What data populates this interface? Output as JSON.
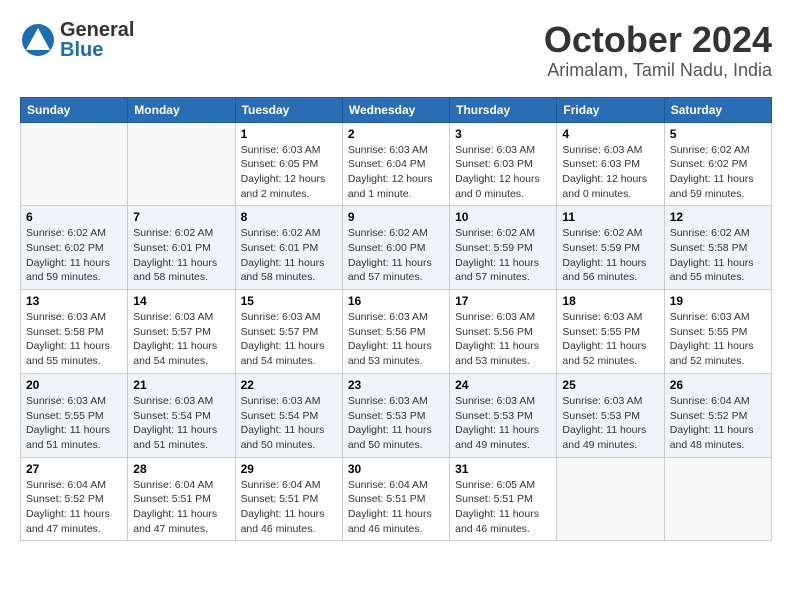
{
  "header": {
    "logo_general": "General",
    "logo_blue": "Blue",
    "title": "October 2024",
    "subtitle": "Arimalam, Tamil Nadu, India"
  },
  "days_of_week": [
    "Sunday",
    "Monday",
    "Tuesday",
    "Wednesday",
    "Thursday",
    "Friday",
    "Saturday"
  ],
  "weeks": [
    [
      {
        "day": "",
        "info": ""
      },
      {
        "day": "",
        "info": ""
      },
      {
        "day": "1",
        "info": "Sunrise: 6:03 AM\nSunset: 6:05 PM\nDaylight: 12 hours\nand 2 minutes."
      },
      {
        "day": "2",
        "info": "Sunrise: 6:03 AM\nSunset: 6:04 PM\nDaylight: 12 hours\nand 1 minute."
      },
      {
        "day": "3",
        "info": "Sunrise: 6:03 AM\nSunset: 6:03 PM\nDaylight: 12 hours\nand 0 minutes."
      },
      {
        "day": "4",
        "info": "Sunrise: 6:03 AM\nSunset: 6:03 PM\nDaylight: 12 hours\nand 0 minutes."
      },
      {
        "day": "5",
        "info": "Sunrise: 6:02 AM\nSunset: 6:02 PM\nDaylight: 11 hours\nand 59 minutes."
      }
    ],
    [
      {
        "day": "6",
        "info": "Sunrise: 6:02 AM\nSunset: 6:02 PM\nDaylight: 11 hours\nand 59 minutes."
      },
      {
        "day": "7",
        "info": "Sunrise: 6:02 AM\nSunset: 6:01 PM\nDaylight: 11 hours\nand 58 minutes."
      },
      {
        "day": "8",
        "info": "Sunrise: 6:02 AM\nSunset: 6:01 PM\nDaylight: 11 hours\nand 58 minutes."
      },
      {
        "day": "9",
        "info": "Sunrise: 6:02 AM\nSunset: 6:00 PM\nDaylight: 11 hours\nand 57 minutes."
      },
      {
        "day": "10",
        "info": "Sunrise: 6:02 AM\nSunset: 5:59 PM\nDaylight: 11 hours\nand 57 minutes."
      },
      {
        "day": "11",
        "info": "Sunrise: 6:02 AM\nSunset: 5:59 PM\nDaylight: 11 hours\nand 56 minutes."
      },
      {
        "day": "12",
        "info": "Sunrise: 6:02 AM\nSunset: 5:58 PM\nDaylight: 11 hours\nand 55 minutes."
      }
    ],
    [
      {
        "day": "13",
        "info": "Sunrise: 6:03 AM\nSunset: 5:58 PM\nDaylight: 11 hours\nand 55 minutes."
      },
      {
        "day": "14",
        "info": "Sunrise: 6:03 AM\nSunset: 5:57 PM\nDaylight: 11 hours\nand 54 minutes."
      },
      {
        "day": "15",
        "info": "Sunrise: 6:03 AM\nSunset: 5:57 PM\nDaylight: 11 hours\nand 54 minutes."
      },
      {
        "day": "16",
        "info": "Sunrise: 6:03 AM\nSunset: 5:56 PM\nDaylight: 11 hours\nand 53 minutes."
      },
      {
        "day": "17",
        "info": "Sunrise: 6:03 AM\nSunset: 5:56 PM\nDaylight: 11 hours\nand 53 minutes."
      },
      {
        "day": "18",
        "info": "Sunrise: 6:03 AM\nSunset: 5:55 PM\nDaylight: 11 hours\nand 52 minutes."
      },
      {
        "day": "19",
        "info": "Sunrise: 6:03 AM\nSunset: 5:55 PM\nDaylight: 11 hours\nand 52 minutes."
      }
    ],
    [
      {
        "day": "20",
        "info": "Sunrise: 6:03 AM\nSunset: 5:55 PM\nDaylight: 11 hours\nand 51 minutes."
      },
      {
        "day": "21",
        "info": "Sunrise: 6:03 AM\nSunset: 5:54 PM\nDaylight: 11 hours\nand 51 minutes."
      },
      {
        "day": "22",
        "info": "Sunrise: 6:03 AM\nSunset: 5:54 PM\nDaylight: 11 hours\nand 50 minutes."
      },
      {
        "day": "23",
        "info": "Sunrise: 6:03 AM\nSunset: 5:53 PM\nDaylight: 11 hours\nand 50 minutes."
      },
      {
        "day": "24",
        "info": "Sunrise: 6:03 AM\nSunset: 5:53 PM\nDaylight: 11 hours\nand 49 minutes."
      },
      {
        "day": "25",
        "info": "Sunrise: 6:03 AM\nSunset: 5:53 PM\nDaylight: 11 hours\nand 49 minutes."
      },
      {
        "day": "26",
        "info": "Sunrise: 6:04 AM\nSunset: 5:52 PM\nDaylight: 11 hours\nand 48 minutes."
      }
    ],
    [
      {
        "day": "27",
        "info": "Sunrise: 6:04 AM\nSunset: 5:52 PM\nDaylight: 11 hours\nand 47 minutes."
      },
      {
        "day": "28",
        "info": "Sunrise: 6:04 AM\nSunset: 5:51 PM\nDaylight: 11 hours\nand 47 minutes."
      },
      {
        "day": "29",
        "info": "Sunrise: 6:04 AM\nSunset: 5:51 PM\nDaylight: 11 hours\nand 46 minutes."
      },
      {
        "day": "30",
        "info": "Sunrise: 6:04 AM\nSunset: 5:51 PM\nDaylight: 11 hours\nand 46 minutes."
      },
      {
        "day": "31",
        "info": "Sunrise: 6:05 AM\nSunset: 5:51 PM\nDaylight: 11 hours\nand 46 minutes."
      },
      {
        "day": "",
        "info": ""
      },
      {
        "day": "",
        "info": ""
      }
    ]
  ]
}
